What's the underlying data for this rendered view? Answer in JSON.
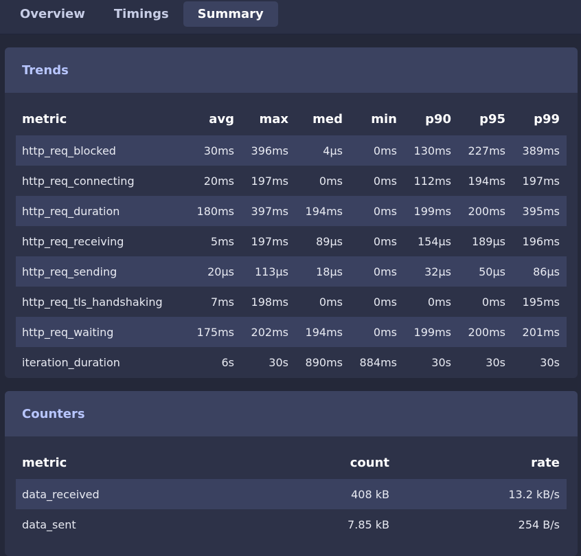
{
  "tabs": [
    {
      "label": "Overview"
    },
    {
      "label": "Timings"
    },
    {
      "label": "Summary"
    }
  ],
  "trends": {
    "title": "Trends",
    "columns": [
      "metric",
      "avg",
      "max",
      "med",
      "min",
      "p90",
      "p95",
      "p99"
    ],
    "rows": [
      [
        "http_req_blocked",
        "30ms",
        "396ms",
        "4µs",
        "0ms",
        "130ms",
        "227ms",
        "389ms"
      ],
      [
        "http_req_connecting",
        "20ms",
        "197ms",
        "0ms",
        "0ms",
        "112ms",
        "194ms",
        "197ms"
      ],
      [
        "http_req_duration",
        "180ms",
        "397ms",
        "194ms",
        "0ms",
        "199ms",
        "200ms",
        "395ms"
      ],
      [
        "http_req_receiving",
        "5ms",
        "197ms",
        "89µs",
        "0ms",
        "154µs",
        "189µs",
        "196ms"
      ],
      [
        "http_req_sending",
        "20µs",
        "113µs",
        "18µs",
        "0ms",
        "32µs",
        "50µs",
        "86µs"
      ],
      [
        "http_req_tls_handshaking",
        "7ms",
        "198ms",
        "0ms",
        "0ms",
        "0ms",
        "0ms",
        "195ms"
      ],
      [
        "http_req_waiting",
        "175ms",
        "202ms",
        "194ms",
        "0ms",
        "199ms",
        "200ms",
        "201ms"
      ],
      [
        "iteration_duration",
        "6s",
        "30s",
        "890ms",
        "884ms",
        "30s",
        "30s",
        "30s"
      ]
    ]
  },
  "counters": {
    "title": "Counters",
    "columns": [
      "metric",
      "count",
      "rate"
    ],
    "rows": [
      [
        "data_received",
        "408 kB",
        "13.2 kB/s"
      ],
      [
        "data_sent",
        "7.85 kB",
        "254 B/s"
      ]
    ]
  }
}
